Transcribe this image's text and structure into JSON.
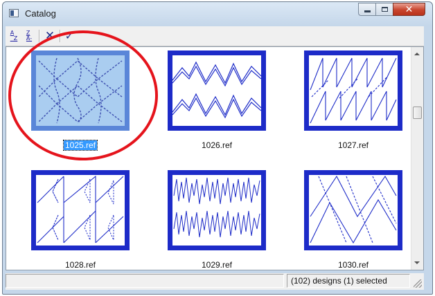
{
  "window": {
    "title": "Catalog"
  },
  "toolbar": {
    "sort_asc_icon": "sort-ascending-icon",
    "sort_desc_icon": "sort-descending-icon",
    "delete_icon": "delete-x-icon",
    "accept_icon": "checkmark-icon"
  },
  "designs": [
    {
      "label": "1025.ref",
      "selected": true
    },
    {
      "label": "1026.ref",
      "selected": false
    },
    {
      "label": "1027.ref",
      "selected": false
    },
    {
      "label": "1028.ref",
      "selected": false
    },
    {
      "label": "1029.ref",
      "selected": false
    },
    {
      "label": "1030.ref",
      "selected": false
    }
  ],
  "status": {
    "summary": "(102) designs  (1) selected"
  },
  "colors": {
    "thumb_border": "#1d2bc8",
    "selection": "#3399ff",
    "annotation": "#e5141c"
  }
}
